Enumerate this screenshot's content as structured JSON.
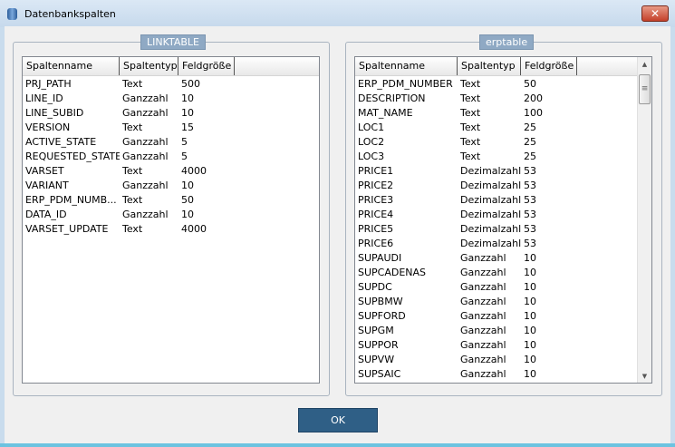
{
  "window": {
    "title": "Datenbankspalten",
    "close_label": "✕"
  },
  "left": {
    "title": "LINKTABLE",
    "headers": [
      "Spaltenname",
      "Spaltentyp",
      "Feldgröße"
    ],
    "rows": [
      [
        "PRJ_PATH",
        "Text",
        "500"
      ],
      [
        "LINE_ID",
        "Ganzzahl",
        "10"
      ],
      [
        "LINE_SUBID",
        "Ganzzahl",
        "10"
      ],
      [
        "VERSION",
        "Text",
        "15"
      ],
      [
        "ACTIVE_STATE",
        "Ganzzahl",
        "5"
      ],
      [
        "REQUESTED_STATE",
        "Ganzzahl",
        "5"
      ],
      [
        "VARSET",
        "Text",
        "4000"
      ],
      [
        "VARIANT",
        "Ganzzahl",
        "10"
      ],
      [
        "ERP_PDM_NUMB...",
        "Text",
        "50"
      ],
      [
        "DATA_ID",
        "Ganzzahl",
        "10"
      ],
      [
        "VARSET_UPDATE",
        "Text",
        "4000"
      ]
    ]
  },
  "right": {
    "title": "erptable",
    "headers": [
      "Spaltenname",
      "Spaltentyp",
      "Feldgröße"
    ],
    "rows": [
      [
        "ERP_PDM_NUMBER",
        "Text",
        "50"
      ],
      [
        "DESCRIPTION",
        "Text",
        "200"
      ],
      [
        "MAT_NAME",
        "Text",
        "100"
      ],
      [
        "LOC1",
        "Text",
        "25"
      ],
      [
        "LOC2",
        "Text",
        "25"
      ],
      [
        "LOC3",
        "Text",
        "25"
      ],
      [
        "PRICE1",
        "Dezimalzahl",
        "53"
      ],
      [
        "PRICE2",
        "Dezimalzahl",
        "53"
      ],
      [
        "PRICE3",
        "Dezimalzahl",
        "53"
      ],
      [
        "PRICE4",
        "Dezimalzahl",
        "53"
      ],
      [
        "PRICE5",
        "Dezimalzahl",
        "53"
      ],
      [
        "PRICE6",
        "Dezimalzahl",
        "53"
      ],
      [
        "SUPAUDI",
        "Ganzzahl",
        "10"
      ],
      [
        "SUPCADENAS",
        "Ganzzahl",
        "10"
      ],
      [
        "SUPDC",
        "Ganzzahl",
        "10"
      ],
      [
        "SUPBMW",
        "Ganzzahl",
        "10"
      ],
      [
        "SUPFORD",
        "Ganzzahl",
        "10"
      ],
      [
        "SUPGM",
        "Ganzzahl",
        "10"
      ],
      [
        "SUPPOR",
        "Ganzzahl",
        "10"
      ],
      [
        "SUPVW",
        "Ganzzahl",
        "10"
      ],
      [
        "SUPSAIC",
        "Ganzzahl",
        "10"
      ]
    ]
  },
  "ok_label": "OK"
}
